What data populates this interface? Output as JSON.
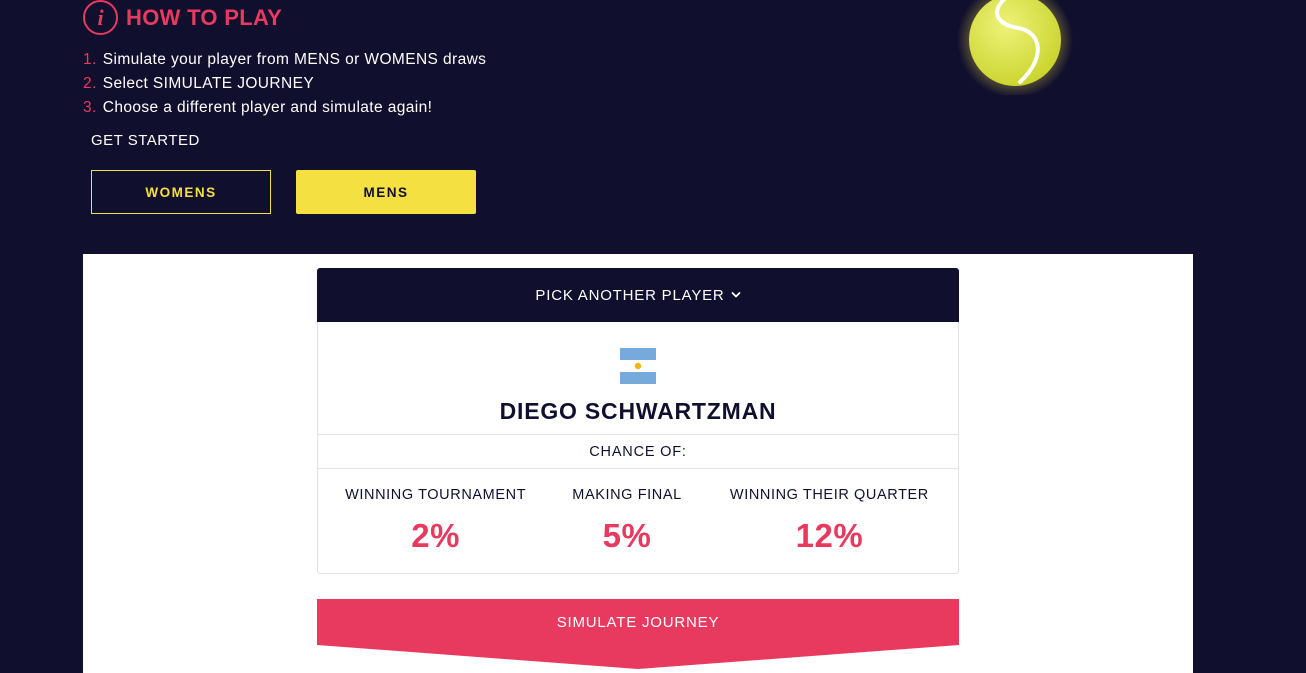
{
  "how_to_play": {
    "title": "HOW TO PLAY",
    "steps": [
      {
        "num": "1.",
        "text": "Simulate your player from MENS or WOMENS draws"
      },
      {
        "num": "2.",
        "text": "Select SIMULATE JOURNEY"
      },
      {
        "num": "3.",
        "text": "Choose a different player and simulate again!"
      }
    ],
    "get_started": "GET STARTED",
    "womens_label": "WOMENS",
    "mens_label": "MENS"
  },
  "player_card": {
    "picker_label": "PICK ANOTHER PLAYER",
    "player_name": "DIEGO SCHWARTZMAN",
    "country_flag": "argentina-flag",
    "chance_of_label": "CHANCE OF:",
    "stats": [
      {
        "label": "WINNING TOURNAMENT",
        "value": "2%"
      },
      {
        "label": "MAKING FINAL",
        "value": "5%"
      },
      {
        "label": "WINNING THEIR QUARTER",
        "value": "12%"
      }
    ],
    "simulate_label": "SIMULATE JOURNEY"
  },
  "colors": {
    "background": "#100f2e",
    "accent_pink": "#e8395f",
    "accent_yellow": "#f4e040",
    "panel": "#ffffff"
  },
  "icons": [
    "info-icon",
    "tennis-ball-icon",
    "chevron-down-icon",
    "argentina-flag"
  ]
}
